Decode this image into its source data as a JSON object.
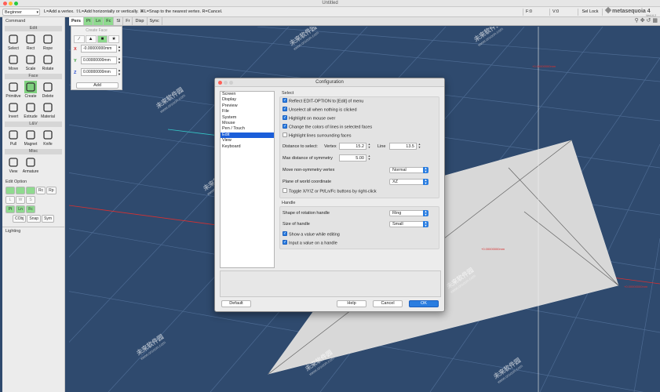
{
  "window": {
    "title": "Untitled"
  },
  "infobar": {
    "mode": "Beginner",
    "hint": "L=Add a vertex.  ⇧L=Add horizontally or vertically.  ⌘L=Snap to the nearest vertex.  R=Cancel.",
    "f_label": "F:0",
    "v_label": "V:0",
    "sel_lock": "Sel Lock",
    "logo": "metasequoia 4",
    "version": "Ver4.6.2"
  },
  "left_panel": {
    "title": "Command",
    "sections": {
      "edit": "Edit",
      "face": "Face",
      "lbv": "L&V",
      "misc": "Misc"
    },
    "edit_tools": [
      "Select",
      "Rect",
      "Rope",
      "Move",
      "Scale",
      "Rotate"
    ],
    "face_tools": [
      "Primitive",
      "Create",
      "Delete",
      "Invert",
      "Extrude",
      "Material"
    ],
    "lbv_tools": [
      "Pull",
      "Magnet",
      "Knife"
    ],
    "misc_tools": [
      "View",
      "Armature"
    ],
    "edit_option_title": "Edit Option",
    "opt_row1": [
      "Rc",
      "Rp"
    ],
    "opt_row2": [
      "L",
      "W",
      "S"
    ],
    "opt_row3": [
      "Pt",
      "Ln",
      "Fc"
    ],
    "opt_row4": [
      "CObj",
      "Snap",
      "Sym"
    ],
    "lighting": "Lighting"
  },
  "vp_tabs": [
    "Pers",
    "Pt",
    "Ln",
    "Fc",
    "Sl",
    "Fr",
    "Disp",
    "Sync"
  ],
  "face_palette": {
    "title": "Create Face",
    "x_value": "-0.00000000mm",
    "y_value": "0.00000000mm",
    "z_value": "0.00000000mm",
    "add": "Add"
  },
  "dialog": {
    "title": "Configuration",
    "categories": [
      "Screen",
      "Display",
      "Preview",
      "File",
      "System",
      "Mouse",
      "Pen / Touch",
      "Edit",
      "View",
      "Keyboard"
    ],
    "selected_category": "Edit",
    "select_group": "Select",
    "chk1": "Reflect EDIT-OPTION to [Edit] of menu",
    "chk2": "Unselect all when nothing is clicked",
    "chk3": "Highlight on mouse over",
    "chk4": "Change the colors of lines in selected faces",
    "chk5": "Highlight lines surrounding faces",
    "dist_label": "Distance to select:",
    "vertex_label": "Vertex",
    "vertex_value": "15.2",
    "line_label": "Line",
    "line_value": "13.5",
    "max_sym_label": "Max distance of symmetry",
    "max_sym_value": "5.00",
    "move_nonsym_label": "Move non-symmetry vertex",
    "move_nonsym_value": "Normal",
    "plane_label": "Plane of world coordinate",
    "plane_value": "XZ",
    "toggle_label": "Toggle X/Y/Z or Pt/Ln/Fc buttons by right-click",
    "handle_group": "Handle",
    "shape_rot_label": "Shape of rotation handle",
    "shape_rot_value": "Ring",
    "size_label": "Size of handle",
    "size_value": "Small",
    "show_value_label": "Show a value while editing",
    "input_value_label": "Input a value on a handle",
    "default_btn": "Default",
    "help_btn": "Help",
    "cancel_btn": "Cancel",
    "ok_btn": "OK"
  },
  "viewport_labels": {
    "tl": "+0.00000000mm",
    "tr": "+0.00000000mm",
    "mr": "+0.00000000mm",
    "rr": "+0.00000000mm"
  },
  "watermark": {
    "brand": "未来软件园",
    "url": "www.orsoon.com"
  },
  "colors": {
    "accent": "#2a7de0",
    "active_tool": "#7fd17f",
    "viewport_bg": "#2f4a6e",
    "grid": "#4f6d94"
  }
}
